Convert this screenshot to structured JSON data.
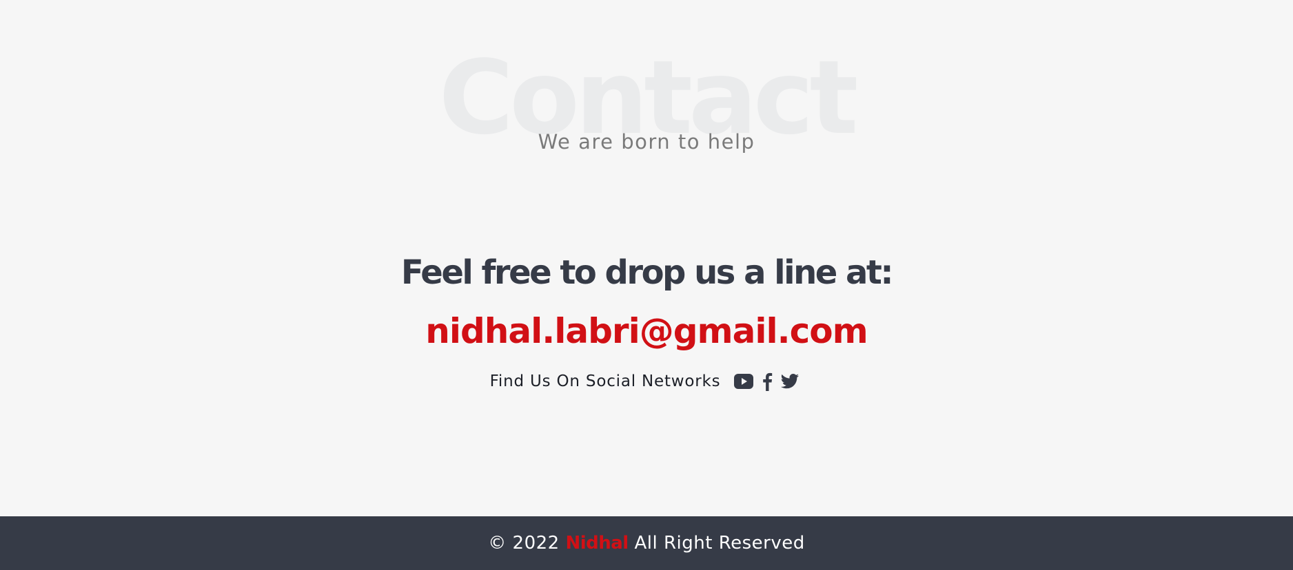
{
  "contact": {
    "background_title": "Contact",
    "subtitle": "We are born to help",
    "headline": "Feel free to drop us a line at:",
    "email": "nidhal.labri@gmail.com",
    "social_label": "Find Us On Social Networks",
    "social_icons": [
      "youtube-icon",
      "facebook-icon",
      "twitter-icon"
    ]
  },
  "footer": {
    "copyright_prefix": "© 2022",
    "brand": "Nidhal",
    "copyright_suffix": "All Right Reserved"
  },
  "colors": {
    "page_background": "#f6f6f6",
    "accent_red": "#d11015",
    "dark_navy": "#363b47",
    "watermark_gray": "#eaebec",
    "subtitle_gray": "#7a7a7a"
  }
}
